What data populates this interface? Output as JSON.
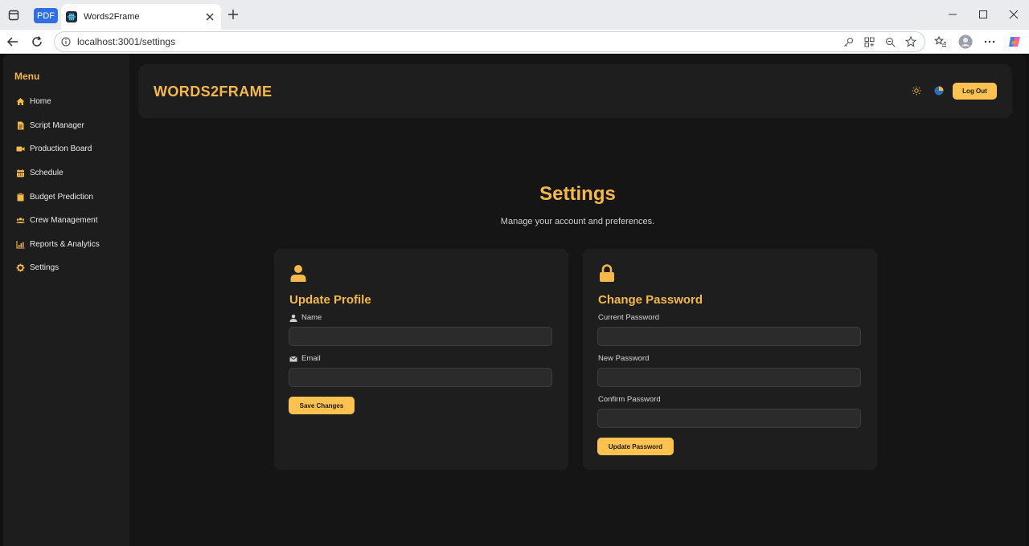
{
  "browser": {
    "pdf_badge": "PDF",
    "tab_title": "Words2Frame",
    "url": "localhost:3001/settings"
  },
  "sidebar": {
    "title": "Menu",
    "items": [
      {
        "label": "Home",
        "icon": "home-icon"
      },
      {
        "label": "Script Manager",
        "icon": "file-icon"
      },
      {
        "label": "Production Board",
        "icon": "video-camera-icon"
      },
      {
        "label": "Schedule",
        "icon": "calendar-icon"
      },
      {
        "label": "Budget Prediction",
        "icon": "clipboard-icon"
      },
      {
        "label": "Crew Management",
        "icon": "users-icon"
      },
      {
        "label": "Reports & Analytics",
        "icon": "chart-icon"
      },
      {
        "label": "Settings",
        "icon": "gear-icon"
      }
    ]
  },
  "header": {
    "brand": "WORDS2FRAME",
    "logout_label": "Log Out"
  },
  "main": {
    "title": "Settings",
    "subtitle": "Manage your account and preferences."
  },
  "profile_card": {
    "title": "Update Profile",
    "name_label": "Name",
    "name_value": "",
    "email_label": "Email",
    "email_value": "",
    "save_label": "Save Changes"
  },
  "password_card": {
    "title": "Change Password",
    "current_label": "Current Password",
    "new_label": "New Password",
    "confirm_label": "Confirm Password",
    "update_label": "Update Password"
  },
  "colors": {
    "accent": "#f6b84a",
    "button": "#ffc14f",
    "background": "#151515",
    "card": "#1e1e1e",
    "sidebar": "#1d1d1d"
  }
}
